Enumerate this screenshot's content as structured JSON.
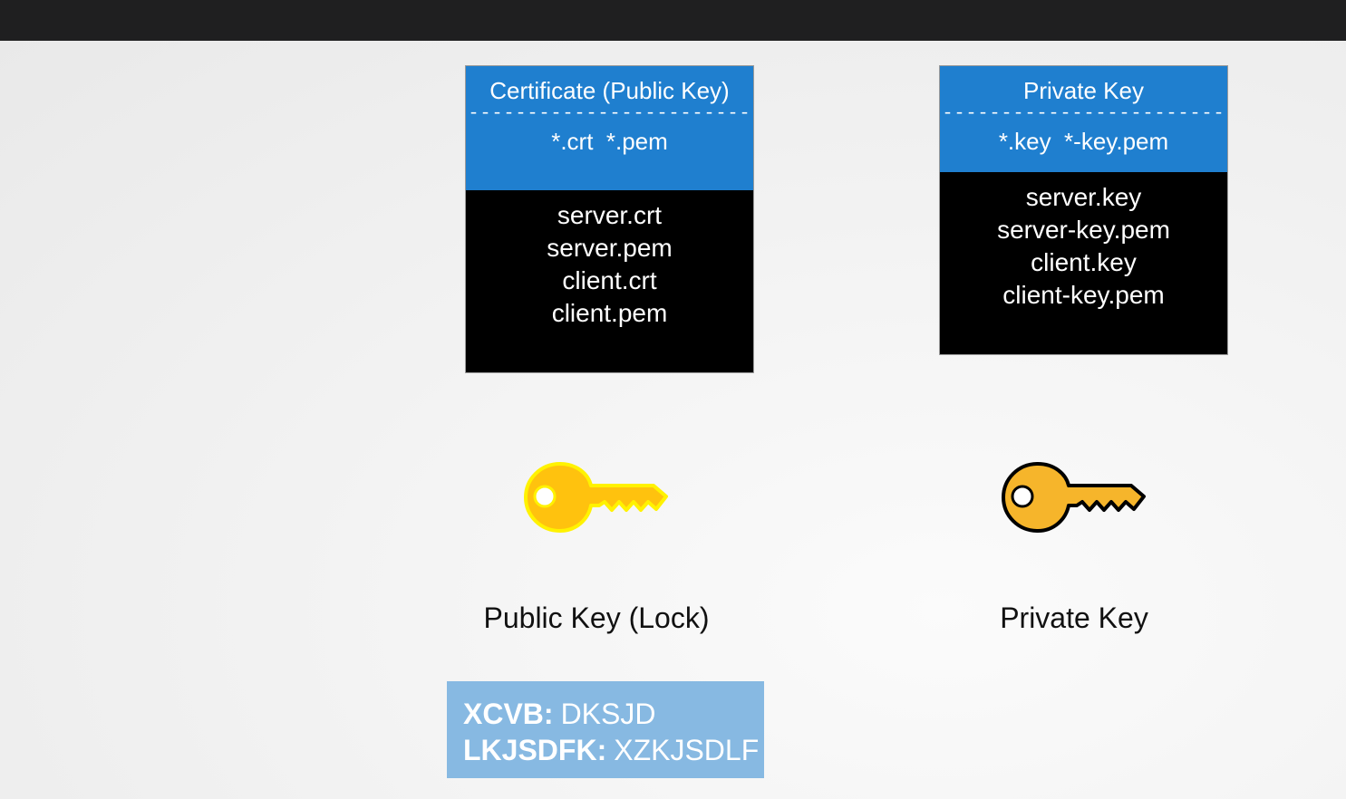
{
  "diagram": {
    "certificate_card": {
      "title": "Certificate (Public Key)",
      "rule": "------------------------",
      "extensions": "*.crt  *.pem",
      "files": [
        "server.crt",
        "server.pem",
        "client.crt",
        "client.pem"
      ]
    },
    "private_key_card": {
      "title": "Private Key",
      "rule": "------------------------",
      "extensions": "*.key  *-key.pem",
      "files": [
        "server.key",
        "server-key.pem",
        "client.key",
        "client-key.pem"
      ]
    },
    "public_key_caption": "Public Key (Lock)",
    "private_key_caption": "Private Key",
    "public_key_icon": "key-icon",
    "private_key_icon": "key-icon",
    "cipher": {
      "rows": [
        {
          "label": "XCVB:",
          "value": "DKSJD"
        },
        {
          "label": "LKJSDFK:",
          "value": "XZKJSDLF"
        }
      ]
    },
    "colors": {
      "header_blue": "#1f7fcf",
      "card_black": "#000000",
      "public_key_fill": "#ffc20e",
      "public_key_outline": "#fff200",
      "private_key_fill": "#f6b52b",
      "private_key_outline": "#000000",
      "cipher_bg": "#87b9e2"
    }
  }
}
